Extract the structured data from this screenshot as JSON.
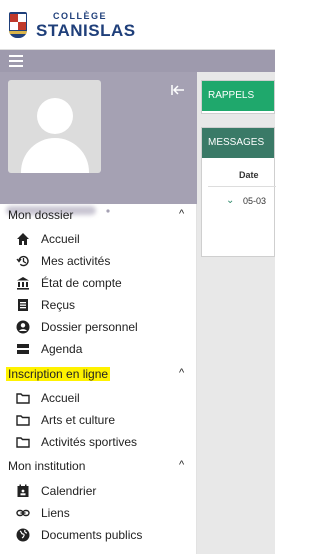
{
  "brand": {
    "small": "COLLÈGE",
    "big": "STANISLAS"
  },
  "colors": {
    "topbar": "#9e9aad",
    "profile_bg": "#a5a1b3",
    "rappels_header": "#1fa86c",
    "messages_header": "#3a7a67",
    "highlight": "#fff200"
  },
  "sidebar": {
    "sections": [
      {
        "title": "Mon dossier",
        "items": [
          {
            "label": "Accueil",
            "icon": "home-icon"
          },
          {
            "label": "Mes activités",
            "icon": "history-icon"
          },
          {
            "label": "État de compte",
            "icon": "bank-icon"
          },
          {
            "label": "Reçus",
            "icon": "receipt-icon"
          },
          {
            "label": "Dossier personnel",
            "icon": "account-circle-icon"
          },
          {
            "label": "Agenda",
            "icon": "agenda-icon"
          }
        ]
      },
      {
        "title": "Inscription en ligne",
        "items": [
          {
            "label": "Accueil",
            "icon": "folder-icon"
          },
          {
            "label": "Arts et culture",
            "icon": "folder-icon"
          },
          {
            "label": "Activités sportives",
            "icon": "folder-icon"
          }
        ]
      },
      {
        "title": "Mon institution",
        "items": [
          {
            "label": "Calendrier",
            "icon": "calendar-icon"
          },
          {
            "label": "Liens",
            "icon": "link-icon"
          },
          {
            "label": "Documents publics",
            "icon": "globe-icon"
          }
        ]
      }
    ]
  },
  "main": {
    "rappels_title": "RAPPELS",
    "messages_title": "MESSAGES",
    "messages_col_date": "Date",
    "messages_row_date": "05-03"
  }
}
